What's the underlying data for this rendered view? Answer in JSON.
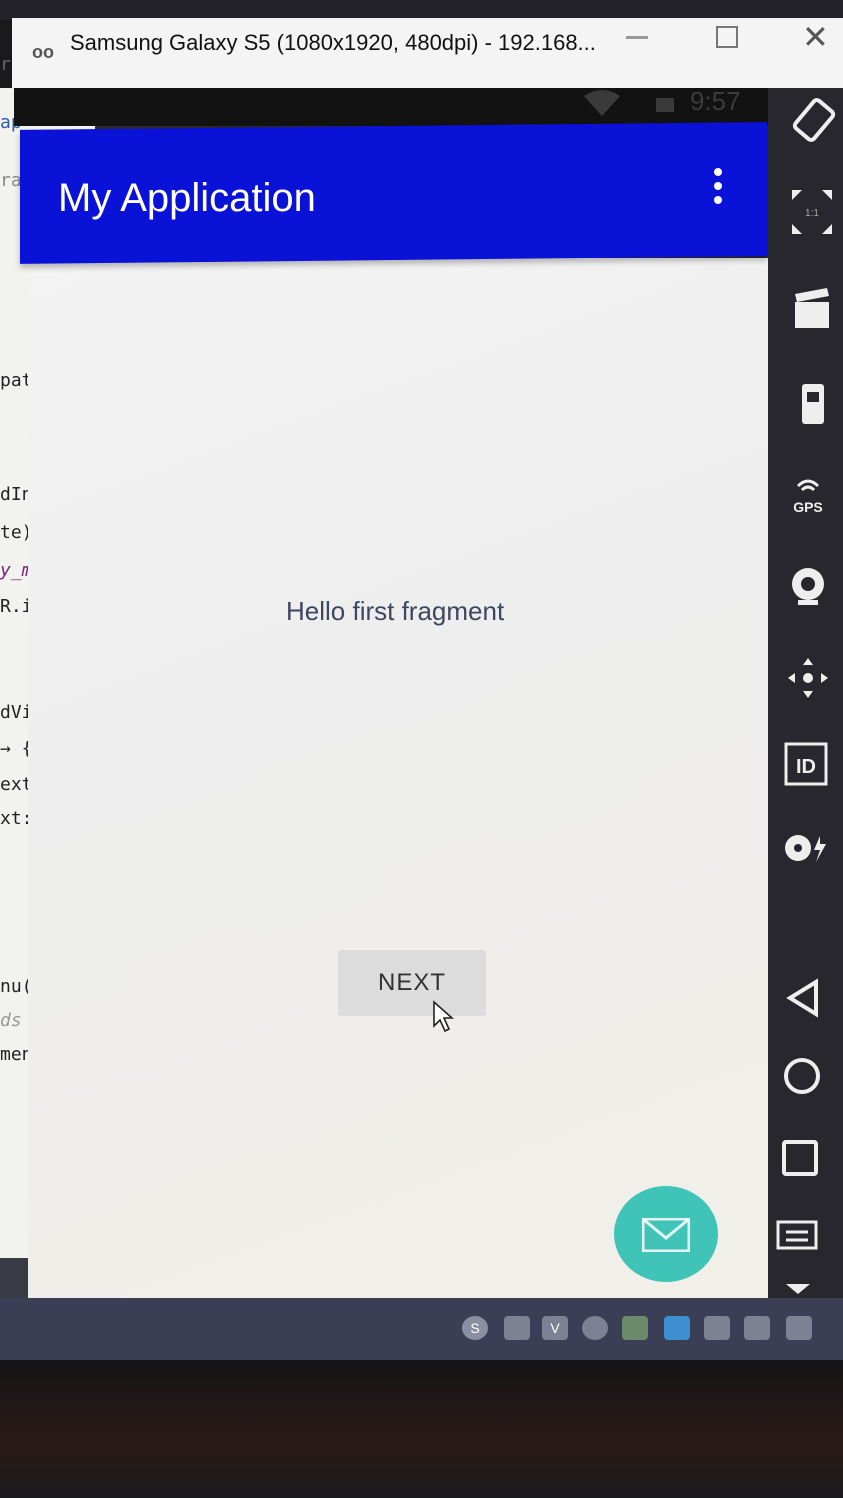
{
  "window": {
    "logo": "oo",
    "title": "Samsung Galaxy S5 (1080x1920, 480dpi) - 192.168...",
    "minimize_icon": "minimize-icon",
    "maximize_icon": "maximize-icon",
    "close_glyph": "✕"
  },
  "statusbar": {
    "time": "9:57",
    "wifi_icon": "wifi-icon",
    "battery_icon": "battery-icon"
  },
  "appbar": {
    "title": "My Application",
    "menu_icon": "overflow-menu-icon",
    "color": "#0a12d8"
  },
  "content": {
    "message": "Hello first fragment",
    "next_button_label": "NEXT"
  },
  "fab": {
    "icon": "mail-icon",
    "color": "#40c4b8"
  },
  "emulator_toolbar": {
    "items": [
      {
        "icon": "rotate-icon"
      },
      {
        "icon": "scale-icon",
        "label": "1:1"
      },
      {
        "icon": "screen-record-icon"
      },
      {
        "icon": "battery-icon"
      },
      {
        "icon": "gps-icon",
        "label": "GPS"
      },
      {
        "icon": "camera-icon"
      },
      {
        "icon": "dpad-icon"
      },
      {
        "icon": "device-id-icon",
        "label": "ID"
      },
      {
        "icon": "media-icon"
      },
      {
        "icon": "back-icon"
      },
      {
        "icon": "home-icon"
      },
      {
        "icon": "recents-icon"
      },
      {
        "icon": "menu-icon"
      },
      {
        "icon": "more-icon"
      }
    ]
  },
  "ide_code_lines": [
    "ra",
    "ap",
    "ra",
    "pat",
    "dIns",
    "te);",
    "y_ma",
    "R.id",
    "dView",
    "→ {",
    "ext: \"F",
    "xt: \"Ac",
    "nu(Menu",
    "ds item",
    "menu.me"
  ],
  "taskbar": {
    "tray_icons": [
      "skype-icon",
      "window-icon",
      "v-icon",
      "cloud-icon",
      "sync-icon",
      "w-icon",
      "network-icon",
      "flag-icon",
      "battery-icon"
    ]
  }
}
